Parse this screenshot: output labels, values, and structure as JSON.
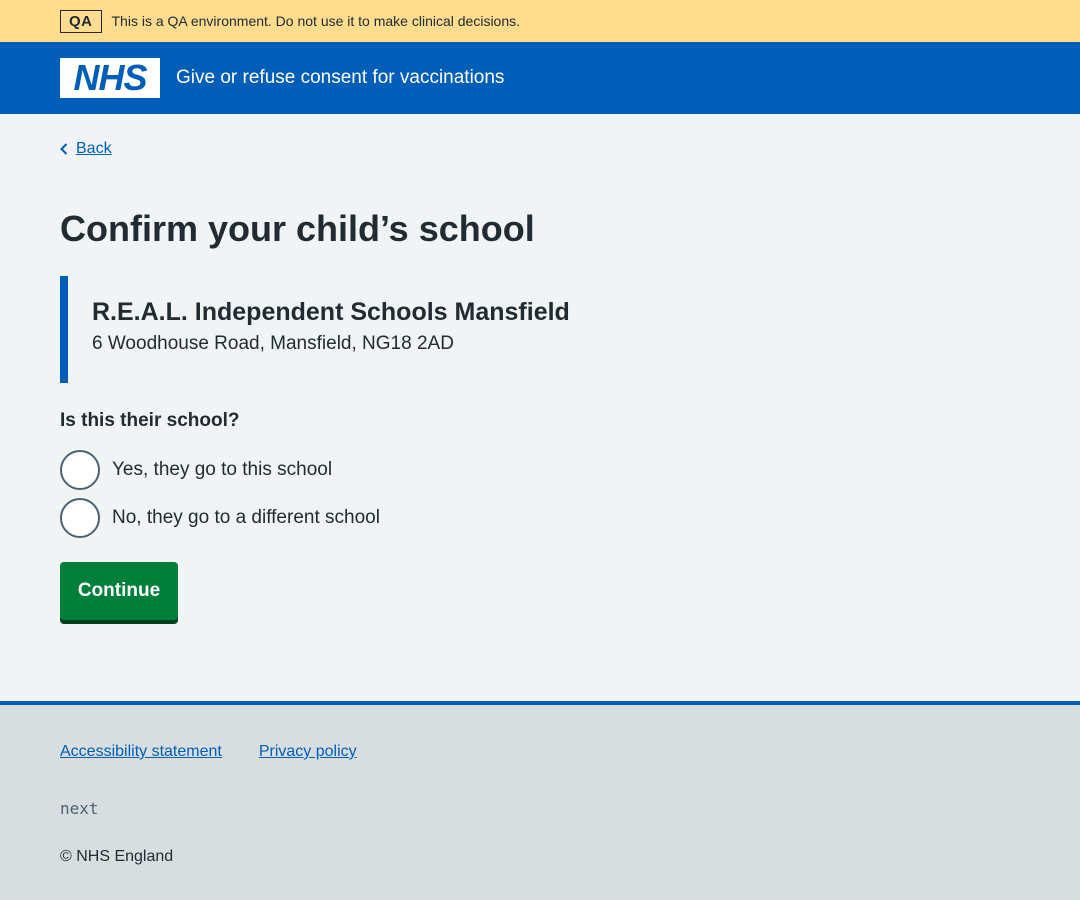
{
  "qa_banner": {
    "tag": "QA",
    "message": "This is a QA environment. Do not use it to make clinical decisions."
  },
  "header": {
    "logo_text": "NHS",
    "service_name": "Give or refuse consent for vaccinations"
  },
  "back_link": {
    "label": "Back",
    "icon": "chevron-left-icon"
  },
  "page": {
    "title": "Confirm your child’s school"
  },
  "school": {
    "name": "R.E.A.L. Independent Schools Mansfield",
    "address": "6 Woodhouse Road, Mansfield, NG18 2AD"
  },
  "question": {
    "legend": "Is this their school?",
    "options": [
      {
        "label": "Yes, they go to this school",
        "selected": false
      },
      {
        "label": "No, they go to a different school",
        "selected": false
      }
    ]
  },
  "continue_label": "Continue",
  "footer": {
    "links": [
      "Accessibility statement",
      "Privacy policy"
    ],
    "version": "next",
    "copyright": "© NHS England"
  },
  "colors": {
    "nhs_blue": "#005eb8",
    "qa_banner": "#ffdc8e",
    "button_green": "#007f3b",
    "page_bg": "#f0f4f5",
    "footer_bg": "#d8dde0",
    "text": "#212b32"
  }
}
